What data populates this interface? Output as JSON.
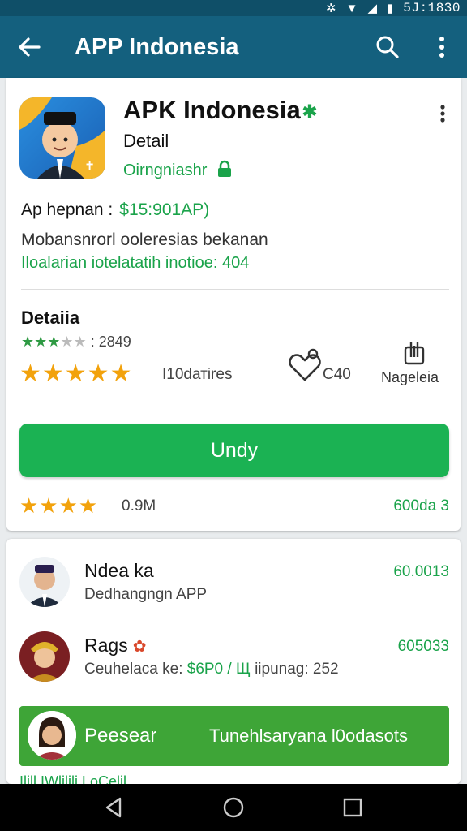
{
  "status_bar": {
    "clock": "5J:1830"
  },
  "app_bar": {
    "title": "APP Indonesia",
    "icons": [
      "back-arrow-icon",
      "search-icon",
      "more-vert-icon"
    ]
  },
  "app_card": {
    "name": "APK Indonesia",
    "subtitle": "Detail",
    "verified_text": "Oirngniashr",
    "price_label": "Ap hepnan :",
    "price_value": "$15:901AP)",
    "description_line1": "Mobansnrorl ooleresias bekanan",
    "description_line2": "Iloalarian iotelatatih inotioe: 404",
    "details": {
      "title": "Detaiia",
      "rating_count": ": 2849",
      "review_label": "I10dатires",
      "favorite_value": "C40",
      "share_label": "Nagelеia"
    },
    "primary_button": "Undy",
    "bottom": {
      "size": "0.9M",
      "right_value": "600da 3"
    }
  },
  "list": [
    {
      "title": "Ndea ka",
      "subtitle": "Dedhangngn APP",
      "value": "60.0013"
    },
    {
      "title": "Rags",
      "subtitle_prefix": "Ceuhelaca ke:",
      "subtitle_accent": "$6P0 / Щ",
      "subtitle_suffix": "iipunag: 252",
      "value": "605033"
    }
  ],
  "promo": {
    "label": "Peesear",
    "message": "Tunehlsaryana l0odasots"
  },
  "peek_text": "Ilill  IWlilili LoCelil",
  "colors": {
    "app_bar": "#14607e",
    "accent_green": "#1bb253",
    "star_orange": "#f2a20c",
    "promo_green": "#3ea537"
  }
}
